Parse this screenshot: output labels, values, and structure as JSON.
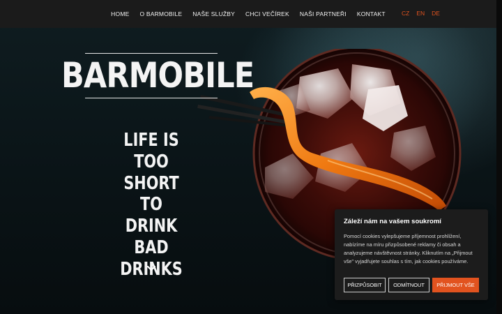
{
  "nav": {
    "items": [
      "HOME",
      "O BARMOBILE",
      "NAŠE SLUŽBY",
      "CHCI VEČÍREK",
      "NAŠI PARTNEŘI",
      "KONTAKT"
    ],
    "languages": [
      "CZ",
      "EN",
      "DE"
    ]
  },
  "hero": {
    "logo": "BARMOBILE",
    "tagline_lines": [
      "LIFE IS",
      "TOO",
      "SHORT",
      "TO DRINK",
      "BAD",
      "DRINKS"
    ]
  },
  "cookie": {
    "title": "Záleží nám na vašem soukromí",
    "text": "Pomocí cookies vylepšujeme příjemnost prohlížení, nabízíme na míru přizpůsobené reklamy či obsah a analyzujeme návštěvnost stránky. Kliknutím na „Přijmout vše\" vyjadřujete souhlas s tím, jak cookies používáme.",
    "customize_label": "PŘIZPŮSOBIT",
    "reject_label": "ODMÍTNOUT",
    "accept_label": "PŘIJMOUT VŠE"
  },
  "colors": {
    "accent": "#e2531f",
    "nav_background": "#1b1b1b",
    "cookie_background": "#1c1c1c"
  },
  "icons": {
    "scroll_down": "chevron-down-icon"
  }
}
